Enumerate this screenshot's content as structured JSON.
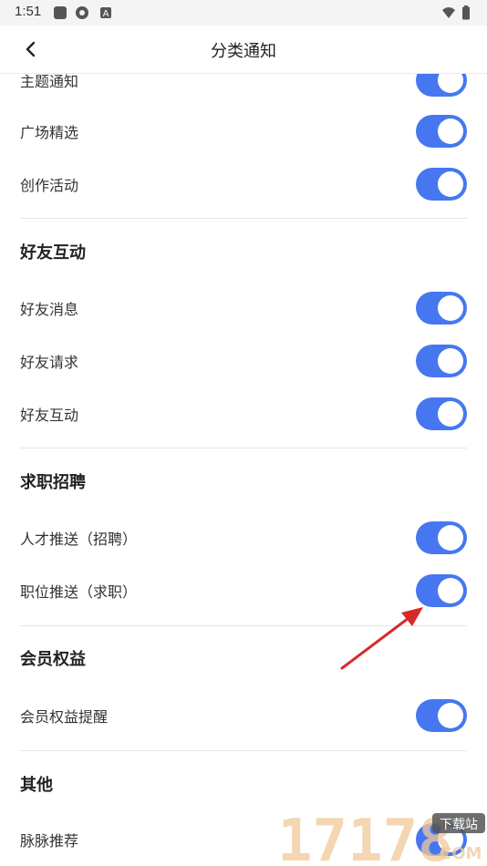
{
  "status_bar": {
    "time": "1:51",
    "icons": [
      "square-icon",
      "aperture-icon",
      "a-badge-icon",
      "wifi-icon",
      "battery-icon"
    ]
  },
  "header": {
    "title": "分类通知"
  },
  "groups": [
    {
      "items": [
        {
          "label": "主题通知",
          "on": true
        },
        {
          "label": "广场精选",
          "on": true
        },
        {
          "label": "创作活动",
          "on": true
        }
      ]
    },
    {
      "title": "好友互动",
      "items": [
        {
          "label": "好友消息",
          "on": true
        },
        {
          "label": "好友请求",
          "on": true
        },
        {
          "label": "好友互动",
          "on": true
        }
      ]
    },
    {
      "title": "求职招聘",
      "items": [
        {
          "label": "人才推送（招聘）",
          "on": true
        },
        {
          "label": "职位推送（求职）",
          "on": true
        }
      ]
    },
    {
      "title": "会员权益",
      "items": [
        {
          "label": "会员权益提醒",
          "on": true
        }
      ]
    },
    {
      "title": "其他",
      "items": [
        {
          "label": "脉脉推荐",
          "on": true
        }
      ]
    }
  ],
  "colors": {
    "toggle_on": "#4677f0",
    "annotation_arrow": "#d62a2a"
  },
  "watermark": {
    "digits": "17178",
    "badge": "下载站",
    "suffix": "COM"
  }
}
